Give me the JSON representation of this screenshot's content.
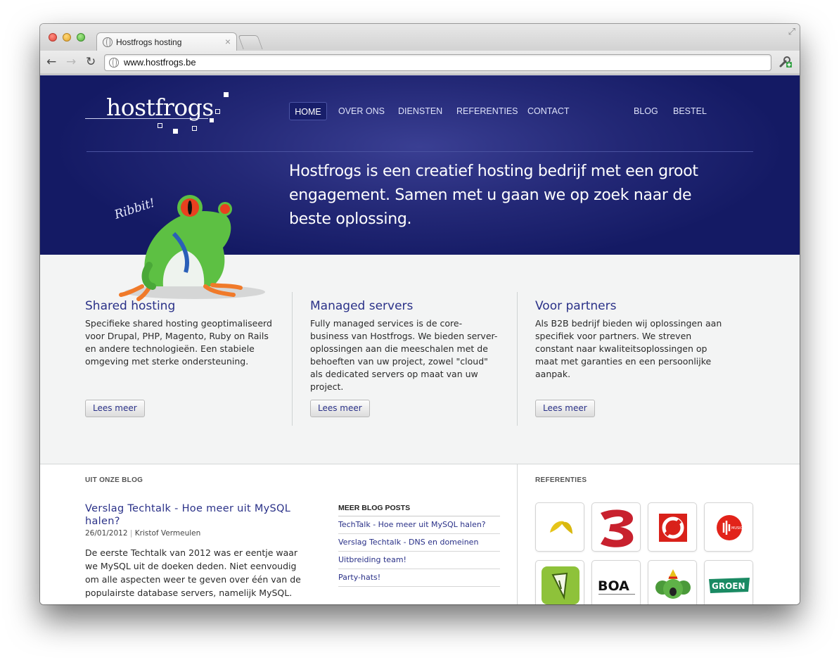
{
  "browser": {
    "tab_title": "Hostfrogs hosting",
    "tab_close": "×",
    "url": "www.hostfrogs.be"
  },
  "site": {
    "logo_text": "hostfrogs",
    "nav": {
      "home": "HOME",
      "over_ons": "OVER ONS",
      "diensten": "DIENSTEN",
      "referenties": "REFERENTIES",
      "contact": "CONTACT",
      "blog": "BLOG",
      "bestel": "BESTEL"
    },
    "tagline": "Hostfrogs is een creatief hosting bedrijf met een groot engagement. Samen met u gaan we op zoek naar de beste oplossing.",
    "frog_caption": "Ribbit!",
    "columns": [
      {
        "title": "Shared hosting",
        "text": "Specifieke shared hosting geoptimaliseerd voor Drupal, PHP, Magento, Ruby on Rails en andere technologieën. Een stabiele omgeving met sterke ondersteuning.",
        "button": "Lees meer"
      },
      {
        "title": "Managed servers",
        "text": "Fully managed services is de core-business van Hostfrogs. We bieden server-oplossingen aan die meeschalen met de behoeften van uw project, zowel \"cloud\" als dedicated servers op maat van uw project.",
        "button": "Lees meer"
      },
      {
        "title": "Voor partners",
        "text": "Als B2B bedrijf bieden wij oplossingen aan specifiek voor partners. We streven constant naar kwaliteitsoplossingen op maat met garanties en een persoonlijke aanpak.",
        "button": "Lees meer"
      }
    ],
    "blog": {
      "label": "UIT ONZE BLOG",
      "post_title": "Verslag Techtalk - Hoe meer uit MySQL halen?",
      "post_date": "26/01/2012",
      "post_sep": "|",
      "post_author": "Kristof Vermeulen",
      "post_excerpt": "De eerste Techtalk van 2012 was er eentje waar we MySQL uit de doeken deden. Niet eenvoudig om alle aspecten weer te geven over één van de populairste database servers, namelijk MySQL.",
      "more_heading": "MEER BLOG POSTS",
      "more_posts": [
        "TechTalk - Hoe meer uit MySQL halen?",
        "Verslag Techtalk - DNS en domeinen",
        "Uitbreiding team!",
        "Party-hats!"
      ]
    },
    "references": {
      "label": "REFERENTIES",
      "logos": [
        {
          "name": "yellow-leaf-logo"
        },
        {
          "name": "vtm-3-logo"
        },
        {
          "name": "red-circle-logo"
        },
        {
          "name": "red-music-logo",
          "text": "MUSIC"
        },
        {
          "name": "green-cone-logo"
        },
        {
          "name": "boa-logo",
          "text": "BOA"
        },
        {
          "name": "koala-logo"
        },
        {
          "name": "groen-logo",
          "text": "GROEN"
        }
      ]
    }
  }
}
